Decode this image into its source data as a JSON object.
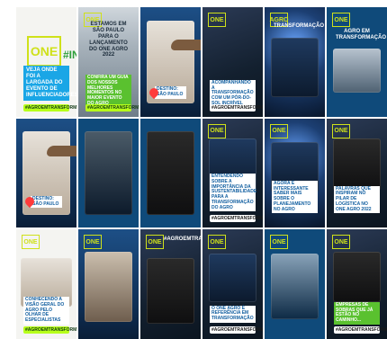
{
  "tiles": [
    {
      "logo": "ONE",
      "hashtag": "#INFLUS",
      "year": "2022",
      "label": "VEJA ONDE FOI A LARGADA DO EVENTO DE INFLUENCIADORES...",
      "pill": "#AGROEMTRANSFORMAÇÃO"
    },
    {
      "logo": "ONE",
      "caption": "ESTAMOS EM SÃO PAULO PARA O LANÇAMENTO DO ONE AGRO 2022",
      "label": "CONFIRA UM GUIA DOS NOSSOS MELHORES MOMENTOS NO MAIOR EVENTO DO AGRO",
      "pill": "#AGROEMTRANSFORMAÇÃO"
    },
    {
      "tag": "Destino: São Paulo"
    },
    {
      "logo": "ONE",
      "label": "ACOMPANHANDO A TRANSFORMAÇÃO COM UM PÓR-DO-SOL INCRÍVEL",
      "pill": "#AGROEMTRANSFORMAÇÃO"
    },
    {
      "logo": "AGRO",
      "caption": "TRANSFORMAÇÃO"
    },
    {
      "logo": "ONE",
      "caption": "AGRO EM TRANSFORMAÇÃO"
    },
    {
      "tag": "Destino: São Paulo"
    },
    {
      "caption": ""
    },
    {
      "caption": ""
    },
    {
      "logo": "ONE",
      "label": "ENTENDENDO SOBRE A IMPORTÂNCIA DA SUSTENTABILIDADE PARA A TRANSFORMAÇÃO DO AGRO",
      "pill": "#AGROEMTRANSFORMAÇÃO"
    },
    {
      "logo": "ONE",
      "label": "AGORA É INTERESSANTE SABER MAIS SOBRE O PLANEJAMENTO NO AGRO",
      "pill": ""
    },
    {
      "logo": "ONE",
      "label": "PALAVRAS QUE INSPIRAM NO PILAR DE LOGÍSTICA NO ONE AGRO 2022",
      "pill": ""
    },
    {
      "logo": "ONE",
      "label": "CONHECENDO A VISÃO GERAL DO AGRO PELO OLHAR DE ESPECIALISTAS",
      "pill": "#AGROEMTRANSFORMAÇÃO"
    },
    {
      "logo": "ONE",
      "caption": ""
    },
    {
      "logo": "ONE",
      "caption": "#AGROEMTRANSFORMAÇÃO"
    },
    {
      "logo": "ONE",
      "label": "O ONE AGRO É REFERÊNCIA EM TRANSFORMAÇÃO",
      "pill": "#AGROEMTRANSFORMAÇÃO"
    },
    {
      "logo": "ONE",
      "caption": ""
    },
    {
      "logo": "ONE",
      "label": "EMPRESAS DE SOBRAS QUE JÁ ESTÃO NO CAMINHO...",
      "pill": "#AGROEMTRANSFORMAÇÃO"
    }
  ]
}
